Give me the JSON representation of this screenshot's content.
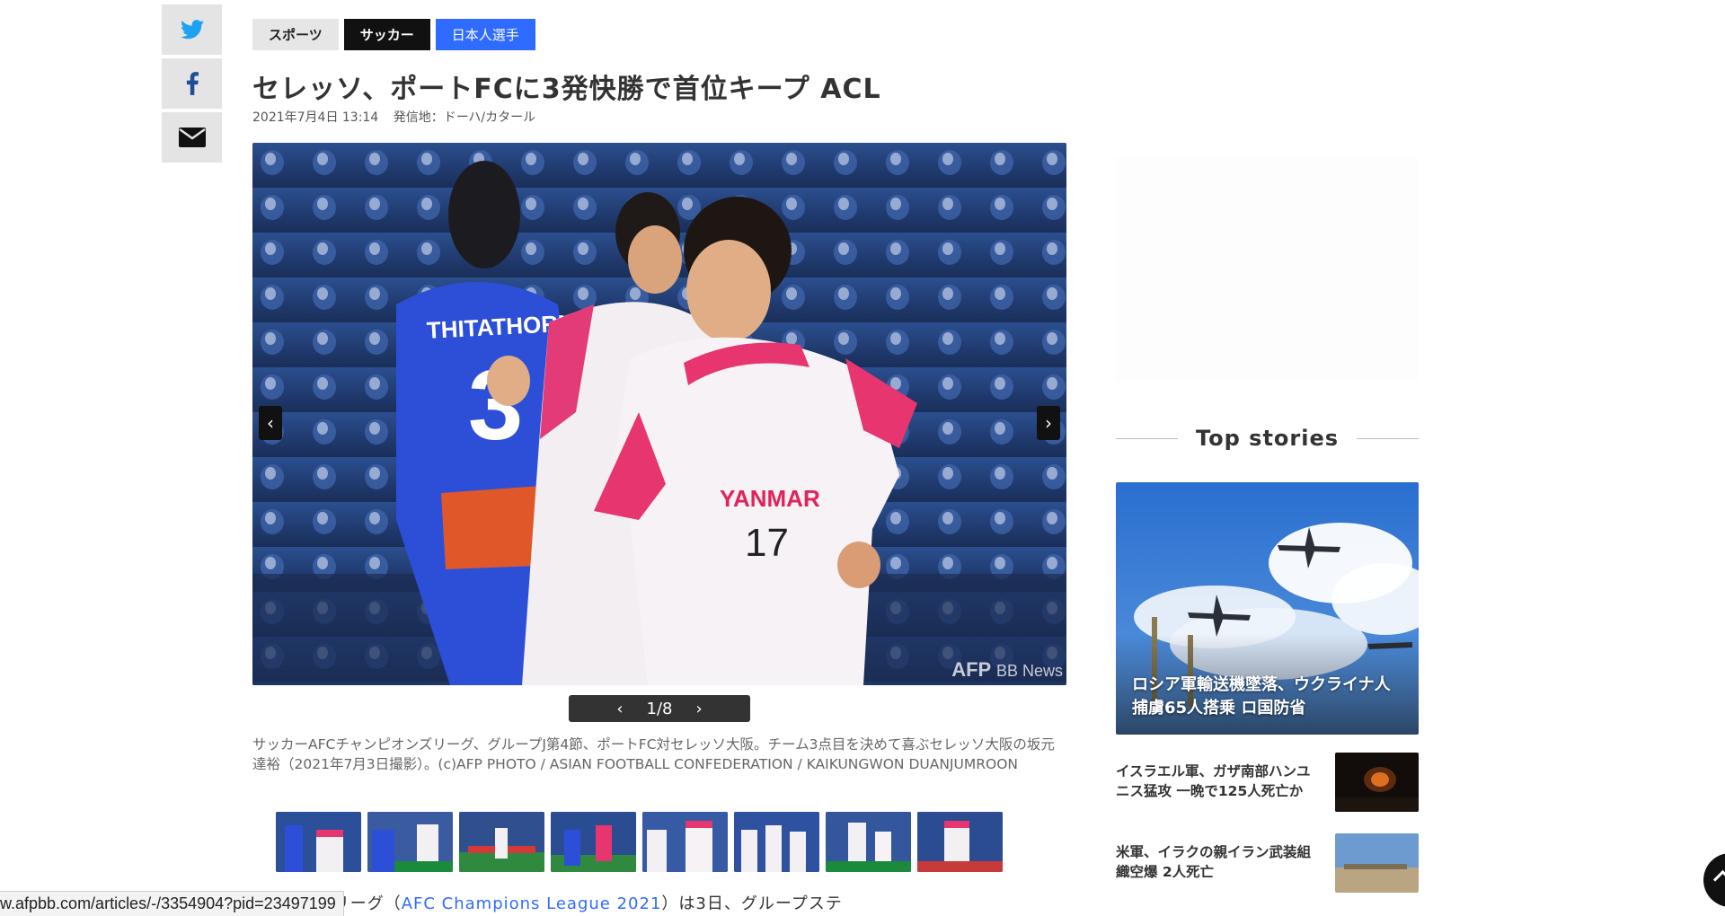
{
  "share": {
    "twitter_icon": "twitter-bird-icon",
    "facebook_icon": "facebook-f-icon",
    "mail_icon": "envelope-icon"
  },
  "article": {
    "tags": [
      "スポーツ",
      "サッカー",
      "日本人選手"
    ],
    "title": "セレッソ、ポートFCに3発快勝で首位キープ ACL",
    "date": "2021年7月4日 13:14",
    "location": "発信地：ドーハ/カタール",
    "photo_credit_afp": "AFP",
    "photo_credit_bb": "BB News",
    "jersey_name": "THITATHORN",
    "sponsor": "YANMAR",
    "pager": {
      "current": "1/8",
      "prev": "‹",
      "next": "›"
    },
    "caption": "サッカーAFCチャンピオンズリーグ、グループJ第4節、ポートFC対セレッソ大阪。チーム3点目を決めて喜ぶセレッソ大阪の坂元達裕（2021年7月3日撮影）。(c)AFP PHOTO / ASIAN FOOTBALL CONFEDERATION / KAIKUNGWON DUANJUMROON",
    "thumbnail_count": 8,
    "body_start": "AFCチャンピオンズリーグ（",
    "body_link": "AFC Champions League 2021",
    "body_end": "）は3日、グループステ"
  },
  "status_url": "w.afpbb.com/articles/-/3354904?pid=23497199",
  "sidebar": {
    "heading": "Top stories",
    "feature": {
      "line1": "ロシア軍輸送機墜落、ウクライナ人",
      "line2": "捕虜65人搭乗 ロ国防省"
    },
    "stories": [
      {
        "line1": "イスラエル軍、ガザ南部ハンユ",
        "line2": "ニス猛攻 一晩で125人死亡か"
      },
      {
        "line1": "米軍、イラクの親イラン武装組",
        "line2": "織空爆 2人死亡"
      }
    ]
  },
  "colors": {
    "accent_blue": "#2f6bff",
    "dark": "#111111",
    "tag_gray": "#e6e6e6"
  }
}
